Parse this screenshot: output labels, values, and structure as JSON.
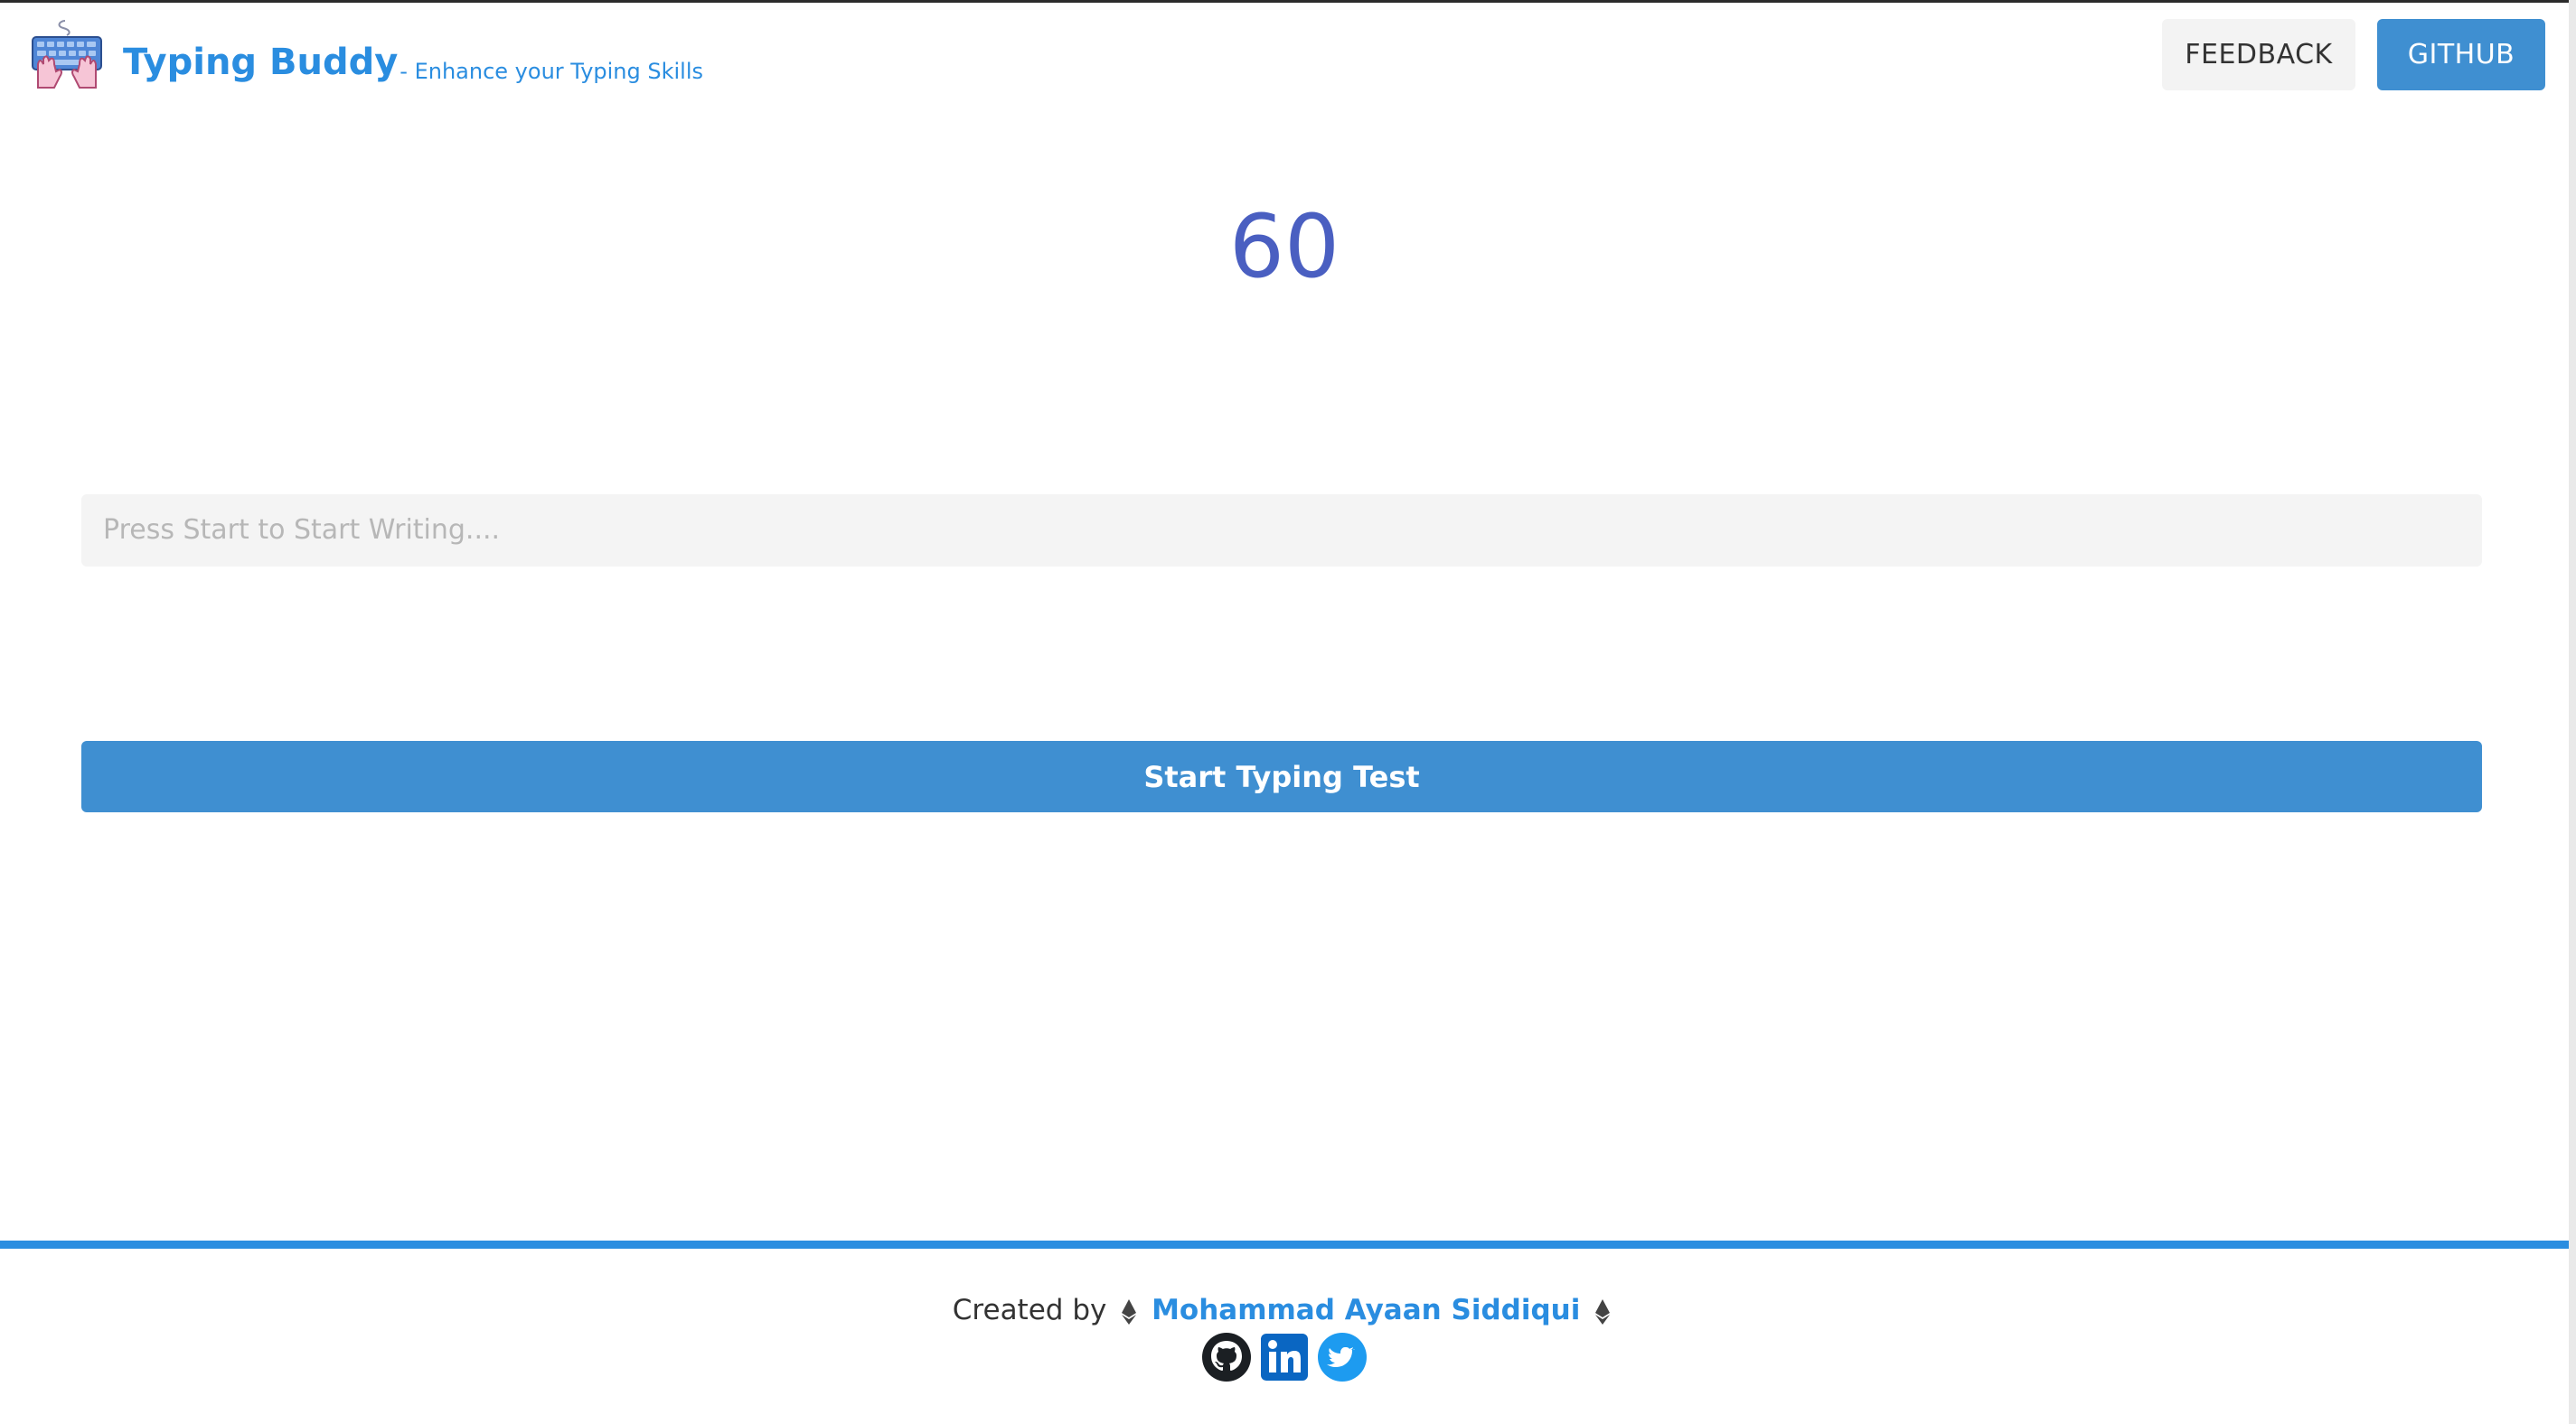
{
  "header": {
    "title": "Typing Buddy",
    "tagline": "- Enhance your Typing Skills",
    "feedback_label": "FEEDBACK",
    "github_label": "GITHUB"
  },
  "main": {
    "timer": "60",
    "input_placeholder": "Press Start to Start Writing....",
    "start_button": "Start Typing Test"
  },
  "footer": {
    "created_by": "Created by",
    "author": "Mohammad Ayaan Siddiqui",
    "socials": [
      "github-icon",
      "linkedin-icon",
      "twitter-icon"
    ]
  },
  "colors": {
    "accent": "#2a8de0",
    "button": "#3f8fd1",
    "timer": "#4a5fc1"
  }
}
